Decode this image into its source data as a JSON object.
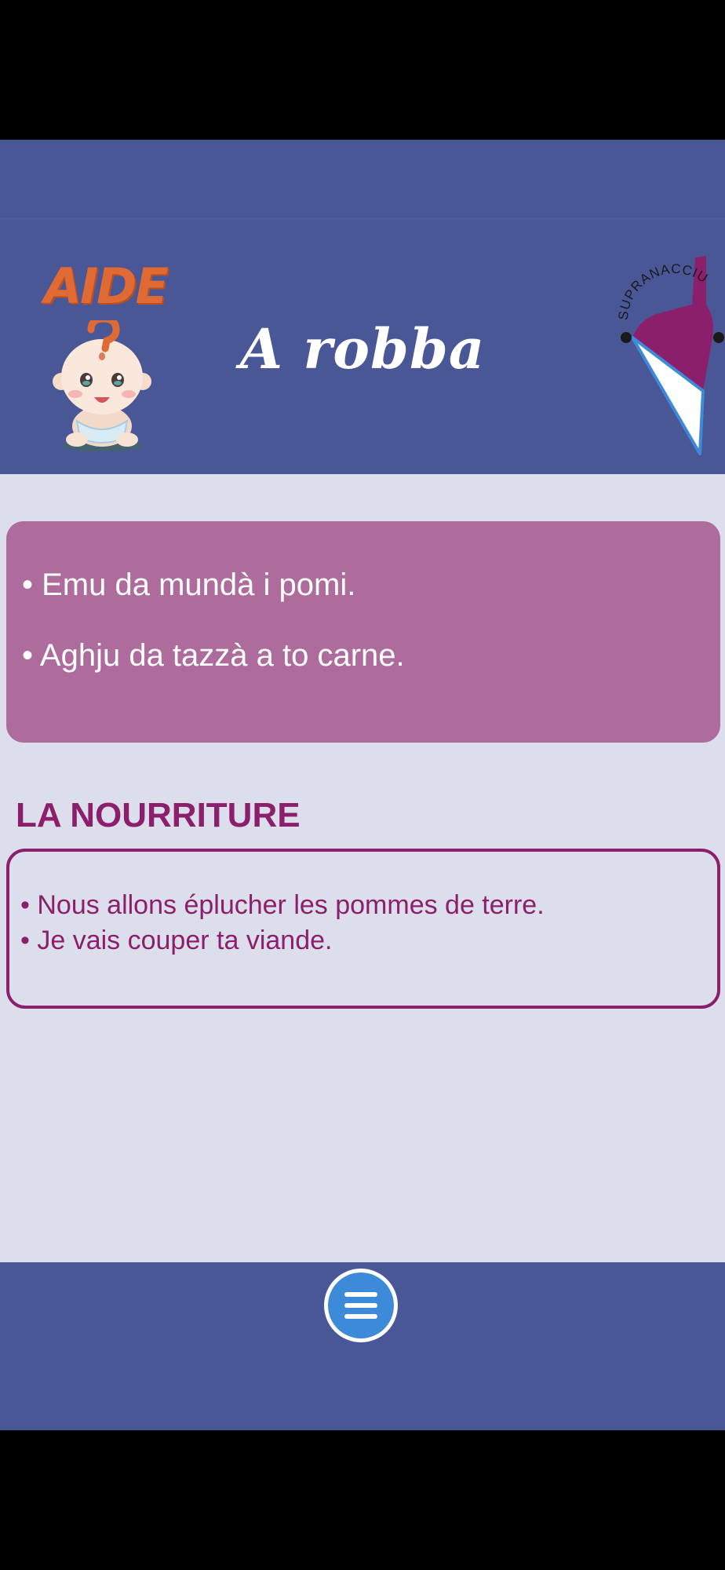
{
  "header": {
    "help_label": "AIDE",
    "title": "A robba",
    "brand_label": "SUPRANACCIU"
  },
  "corsican": {
    "lines": [
      "• Emu da mundà i pomi.",
      "• Aghju da tazzà a to carne."
    ]
  },
  "french": {
    "section_title": "LA NOURRITURE",
    "lines": [
      "• Nous allons éplucher les pommes de terre.",
      "• Je vais couper ta viande."
    ]
  },
  "footer": {
    "menu_icon": "hamburger-menu-icon"
  },
  "colors": {
    "header_bg": "#4a5796",
    "content_bg": "#dcdeeb",
    "corsican_card_bg": "#ad6c9b",
    "accent": "#8c1f6c",
    "menu_button": "#3d8ad8",
    "help_orange": "#e06a34"
  }
}
